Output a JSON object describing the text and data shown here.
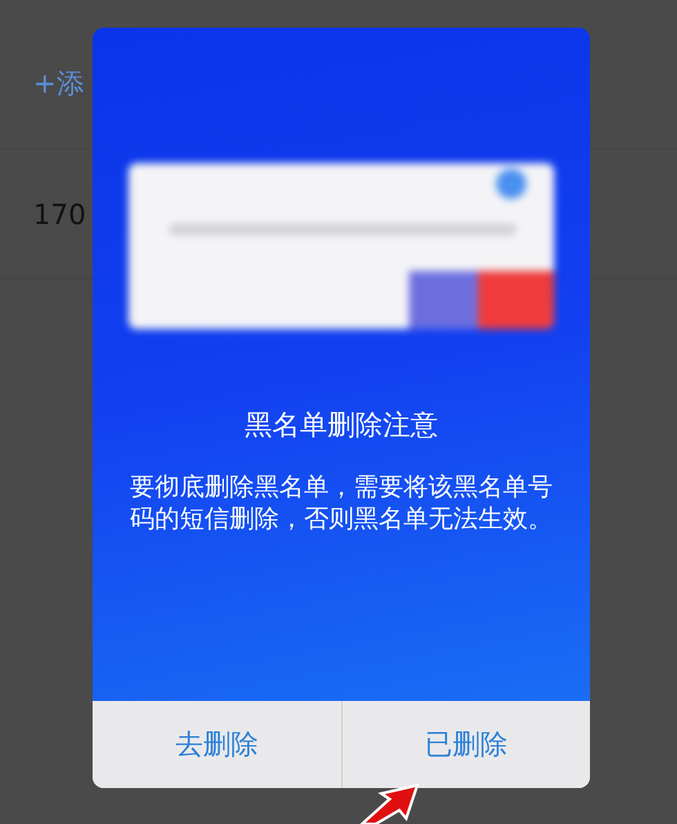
{
  "background_list": [
    {
      "kind": "action",
      "text": "+添"
    },
    {
      "kind": "number",
      "text": "170"
    }
  ],
  "dialog": {
    "title": "黑名单删除注意",
    "message": "要彻底删除黑名单，需要将该黑名单号码的短信删除，否则黑名单无法生效。",
    "buttons": [
      {
        "label": "去删除"
      },
      {
        "label": "已删除"
      }
    ]
  }
}
